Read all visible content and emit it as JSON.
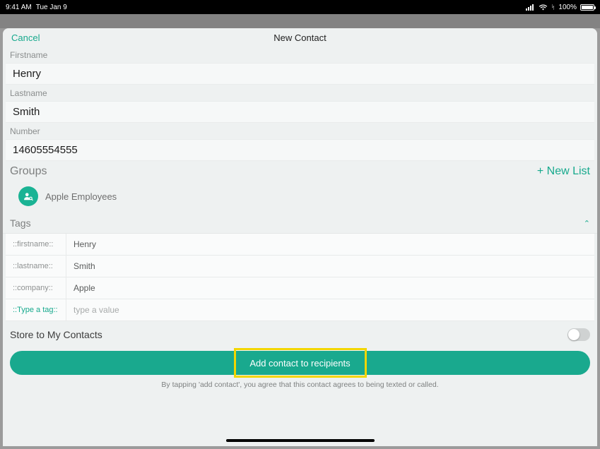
{
  "status": {
    "time": "9:41 AM",
    "date": "Tue Jan 9",
    "battery_pct": "100%",
    "location_glyph": "ᛋ"
  },
  "nav": {
    "cancel": "Cancel",
    "title": "New Contact"
  },
  "fields": {
    "firstname_label": "Firstname",
    "firstname_value": "Henry",
    "lastname_label": "Lastname",
    "lastname_value": "Smith",
    "number_label": "Number",
    "number_value": "14605554555"
  },
  "groups": {
    "header": "Groups",
    "new_list": "+ New List",
    "items": [
      {
        "label": "Apple Employees"
      }
    ]
  },
  "tags": {
    "header": "Tags",
    "rows": [
      {
        "key": "::firstname::",
        "value": "Henry"
      },
      {
        "key": "::lastname::",
        "value": "Smith"
      },
      {
        "key": "::company::",
        "value": "Apple"
      }
    ],
    "new_tag_key_placeholder": "::Type a tag::",
    "new_tag_value_placeholder": "type a value"
  },
  "store": {
    "label": "Store to My Contacts",
    "on": false
  },
  "cta": {
    "label": "Add contact to recipients",
    "disclaimer": "By tapping 'add contact', you agree that this contact agrees to being texted or called."
  }
}
